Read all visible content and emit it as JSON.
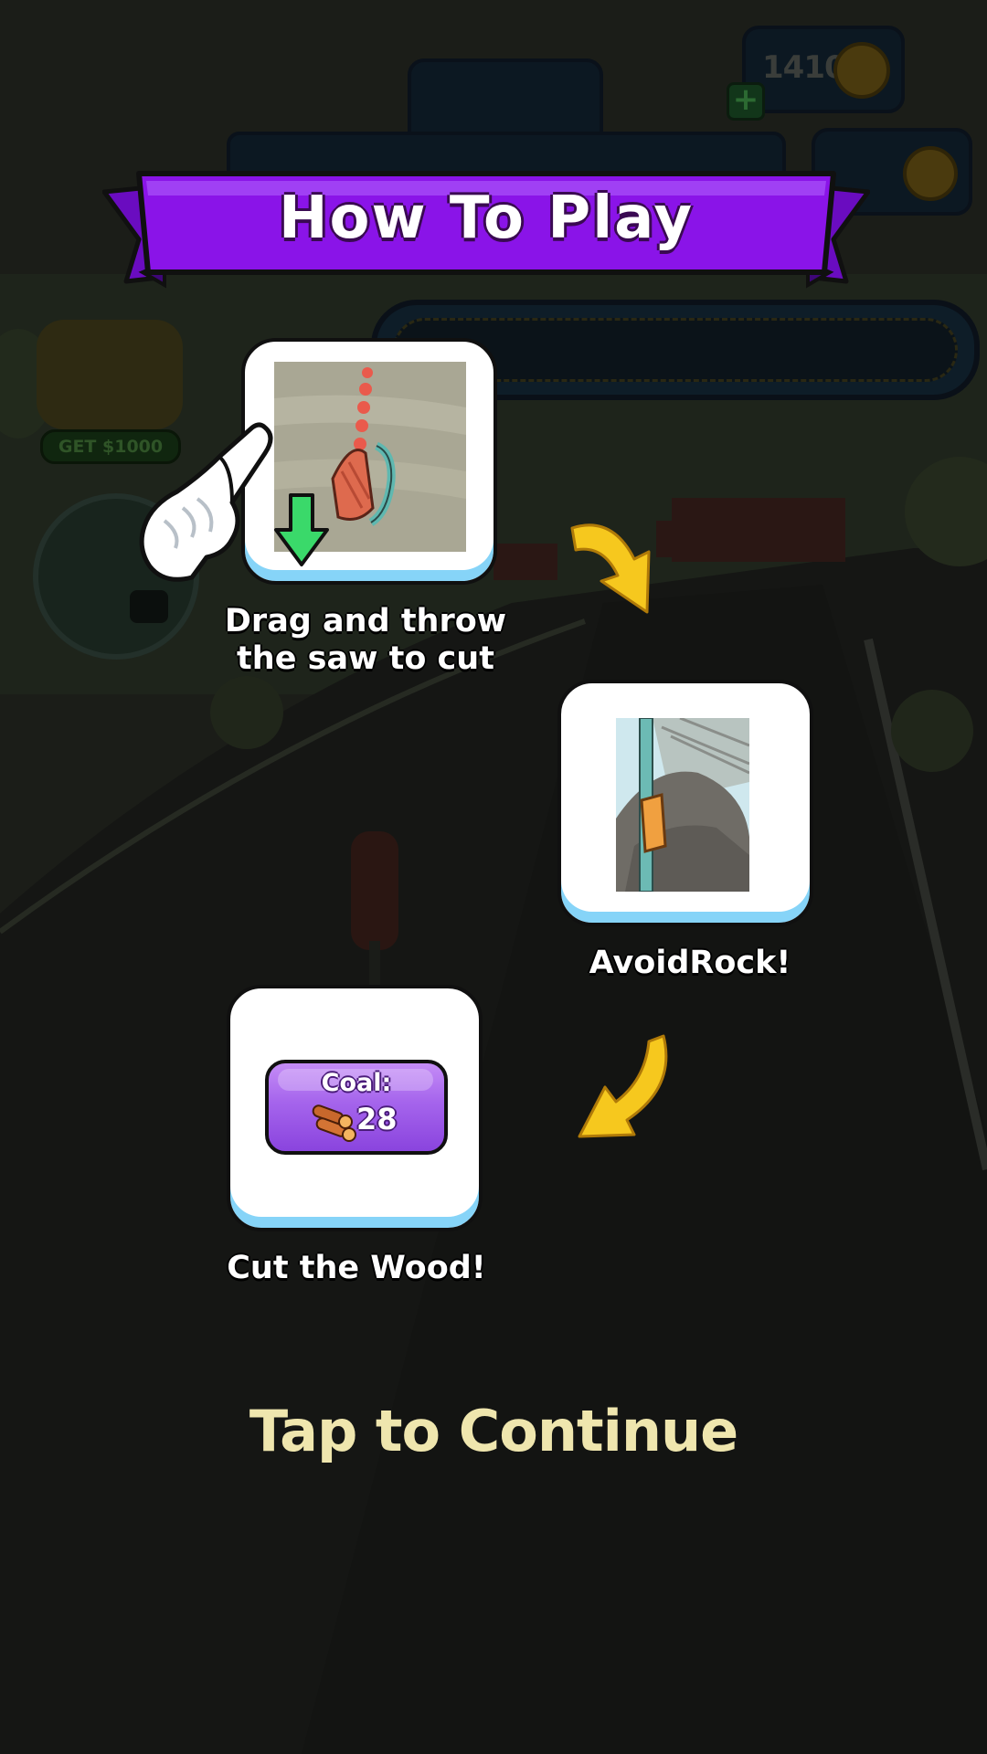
{
  "hud": {
    "coins": "1410",
    "coin_icon": "gold-coin-icon",
    "plus_label": "+",
    "bonus_button_label": "GET $1000"
  },
  "dialog": {
    "title": "How To Play",
    "steps": [
      {
        "caption_line1": "Drag and throw",
        "caption_line2": "the saw to cut",
        "image": "saw-drag-illustration"
      },
      {
        "caption": "AvoidRock!",
        "image": "rock-saw-illustration"
      },
      {
        "caption": "Cut the Wood!",
        "image": "coal-counter-illustration",
        "coal_label": "Coal:",
        "coal_value": "28"
      }
    ],
    "continue_text": "Tap to Continue"
  },
  "colors": {
    "banner_purple": "#8a14e8",
    "card_shadow_blue": "#86d4f8",
    "arrow_yellow": "#f6c81e",
    "continue_text": "#efe6ae",
    "coal_purple": "#a564ec"
  }
}
